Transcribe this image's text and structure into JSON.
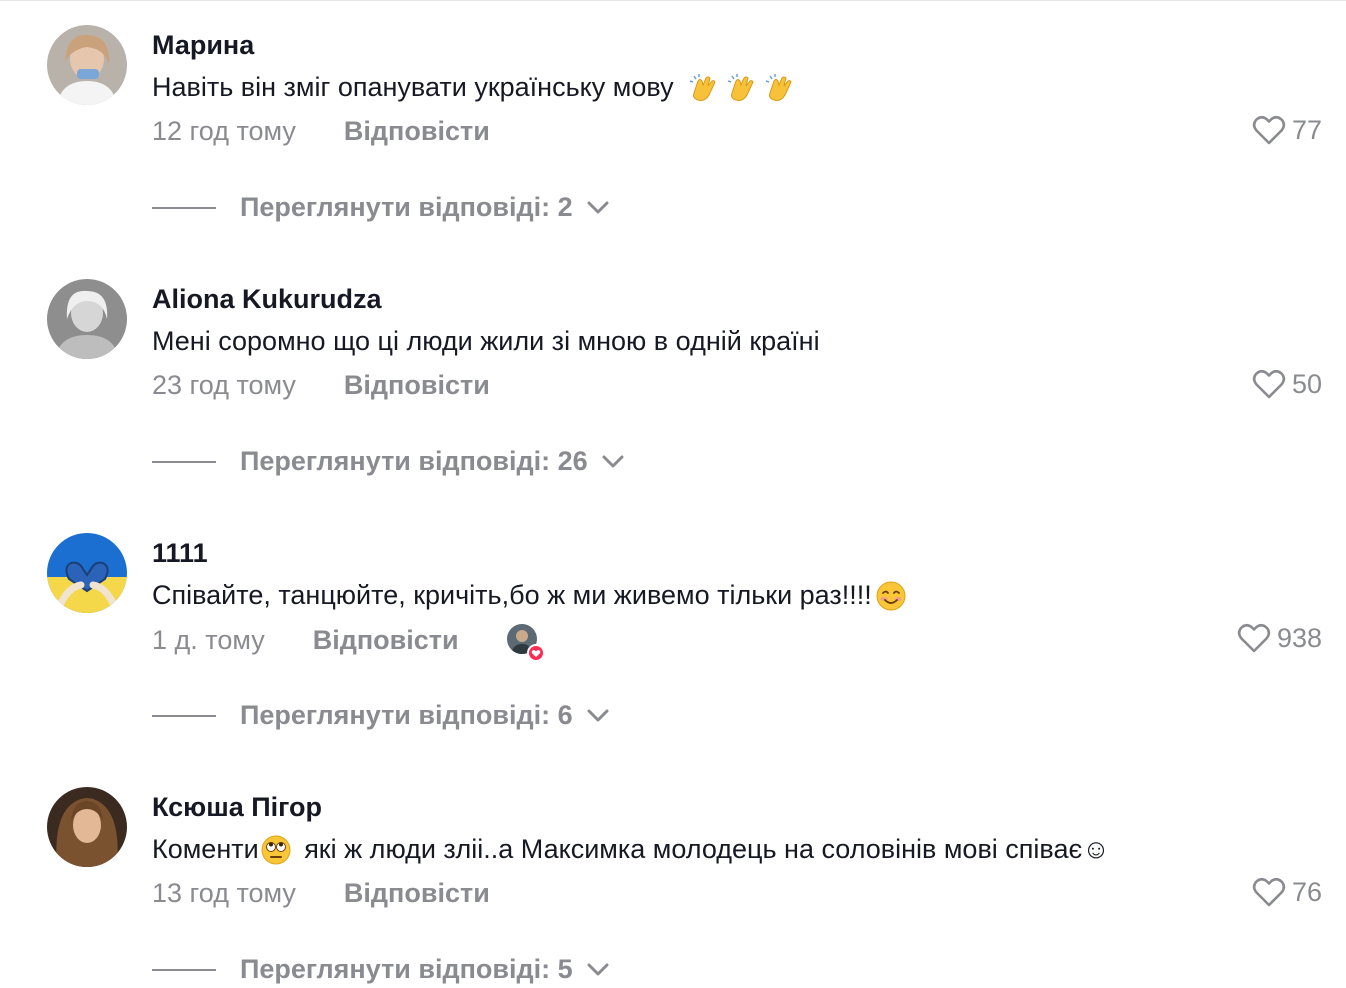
{
  "comments": [
    {
      "username": "Марина",
      "text": "Навіть він зміг опанувати українську мову",
      "emojis": [
        "clapping-hands-icon",
        "clapping-hands-icon",
        "clapping-hands-icon"
      ],
      "time": "12 год тому",
      "reply_label": "Відповісти",
      "likes": "77",
      "view_replies": "Переглянути відповіді: 2"
    },
    {
      "username": "Aliona Kukurudza",
      "text": "Мені соромно що ці люди жили зі мною в одній країні",
      "time": "23 год тому",
      "reply_label": "Відповісти",
      "likes": "50",
      "view_replies": "Переглянути відповіді: 26"
    },
    {
      "username": "1111",
      "text": "Співайте, танцюйте, кричіть,бо ж ми живемо тільки раз!!!!",
      "emojis": [
        "smiling-face-icon"
      ],
      "time": "1 д. тому",
      "reply_label": "Відповісти",
      "liked_by_creator": true,
      "likes": "938",
      "view_replies": "Переглянути відповіді: 6"
    },
    {
      "username": "Ксюша Пігор",
      "text_before": "Коменти",
      "emoji_inline": "eye-roll-face-icon",
      "text_after": " які ж люди зліі..а Максимка молодець на соловінів мові співає☺",
      "time": "13 год тому",
      "reply_label": "Відповісти",
      "likes": "76",
      "view_replies": "Переглянути відповіді: 5"
    }
  ],
  "colors": {
    "text_primary": "#161823",
    "text_secondary": "#8a8b91",
    "accent": "#fe2c55"
  }
}
